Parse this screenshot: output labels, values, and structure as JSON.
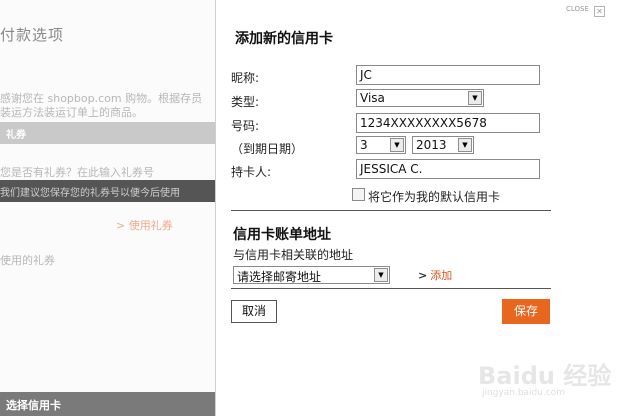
{
  "background": {
    "title": "付款选项",
    "intro_line1": "感谢您在 shopbop.com 购物。根据存员",
    "intro_line2": "装运方法装运订单上的商品。",
    "gift_bar": "礼券",
    "gift_question": "您是否有礼券？在此输入礼券号",
    "dark_bar": "我们建议您保存您的礼券号以便今后使用",
    "use_gift_link": "> 使用礼券",
    "used_gift": "使用的礼券",
    "footer": "选择信用卡"
  },
  "modal": {
    "close_label": "CLOSE",
    "close_x": "✕",
    "title": "添加新的信用卡",
    "fields": {
      "nickname_label": "昵称:",
      "nickname_value": "JC",
      "type_label": "类型:",
      "type_value": "Visa",
      "number_label": "号码:",
      "number_value": "1234XXXXXXXX5678",
      "expiry_label": "（到期日期）",
      "expiry_month": "3",
      "expiry_year": "2013",
      "holder_label": "持卡人:",
      "holder_value": "JESSICA C."
    },
    "default_checkbox_label": "将它作为我的默认信用卡",
    "billing": {
      "title": "信用卡账单地址",
      "subtitle": "与信用卡相关联的地址",
      "select_placeholder": "请选择邮寄地址",
      "add_arrow": ">",
      "add_label": "添加"
    },
    "cancel_label": "取消",
    "save_label": "保存"
  },
  "watermark": {
    "text": "Baidu 经验",
    "sub": "jingyan.baidu.com"
  },
  "colors": {
    "accent": "#e8661e",
    "link": "#d9531e"
  }
}
